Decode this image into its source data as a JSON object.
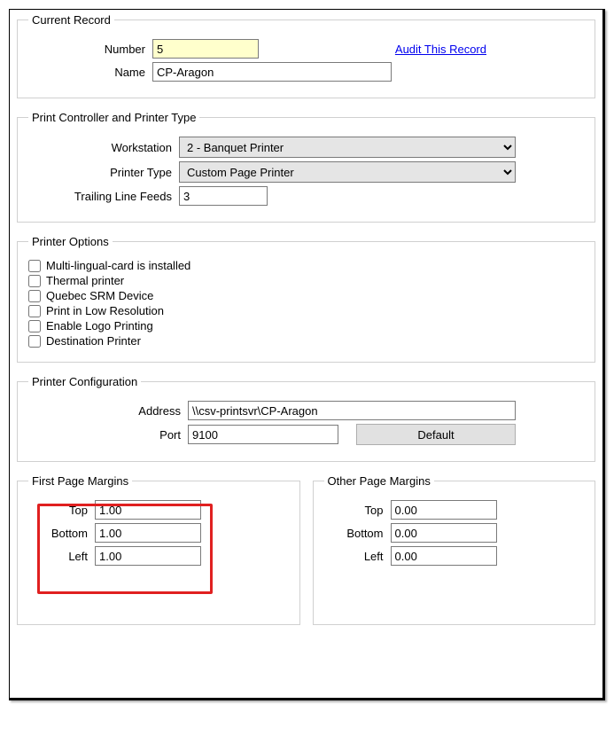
{
  "currentRecord": {
    "legend": "Current Record",
    "numberLabel": "Number",
    "numberValue": "5",
    "nameLabel": "Name",
    "nameValue": "CP-Aragon",
    "auditLink": "Audit This Record"
  },
  "controller": {
    "legend": "Print Controller and Printer Type",
    "workstationLabel": "Workstation",
    "workstationValue": "2 - Banquet Printer",
    "printerTypeLabel": "Printer Type",
    "printerTypeValue": "Custom Page Printer",
    "trailingLabel": "Trailing Line Feeds",
    "trailingValue": "3"
  },
  "options": {
    "legend": "Printer Options",
    "items": [
      "Multi-lingual-card is installed",
      "Thermal printer",
      "Quebec SRM Device",
      "Print in Low Resolution",
      "Enable Logo Printing",
      "Destination Printer"
    ]
  },
  "config": {
    "legend": "Printer Configuration",
    "addressLabel": "Address",
    "addressValue": "\\\\csv-printsvr\\CP-Aragon",
    "portLabel": "Port",
    "portValue": "9100",
    "defaultButton": "Default"
  },
  "firstMargins": {
    "legend": "First Page Margins",
    "topLabel": "Top",
    "topValue": "1.00",
    "bottomLabel": "Bottom",
    "bottomValue": "1.00",
    "leftLabel": "Left",
    "leftValue": "1.00"
  },
  "otherMargins": {
    "legend": "Other Page Margins",
    "topLabel": "Top",
    "topValue": "0.00",
    "bottomLabel": "Bottom",
    "bottomValue": "0.00",
    "leftLabel": "Left",
    "leftValue": "0.00"
  }
}
